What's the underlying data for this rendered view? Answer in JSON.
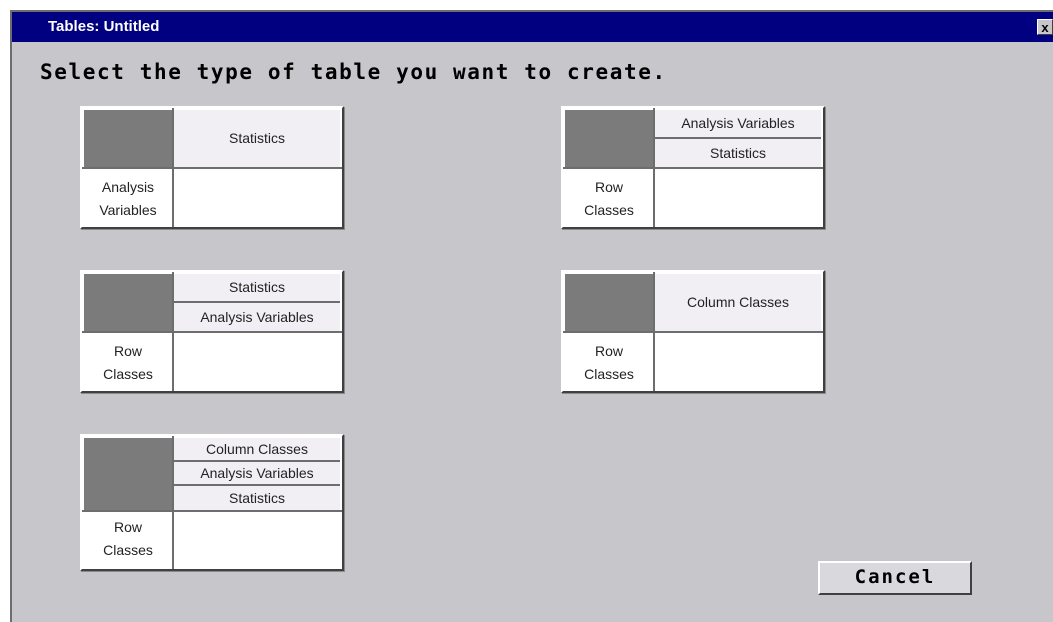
{
  "window": {
    "title": "Tables: Untitled",
    "close_label": "x"
  },
  "instruction": "Select the type of table you want to create.",
  "options": [
    {
      "headers": [
        "Statistics"
      ],
      "row_label": [
        "Analysis",
        "Variables"
      ]
    },
    {
      "headers": [
        "Analysis Variables",
        "Statistics"
      ],
      "row_label": [
        "Row",
        "Classes"
      ]
    },
    {
      "headers": [
        "Statistics",
        "Analysis Variables"
      ],
      "row_label": [
        "Row",
        "Classes"
      ]
    },
    {
      "headers": [
        "Column Classes"
      ],
      "row_label": [
        "Row",
        "Classes"
      ]
    },
    {
      "headers": [
        "Column Classes",
        "Analysis Variables",
        "Statistics"
      ],
      "row_label": [
        "Row",
        "Classes"
      ]
    }
  ],
  "cancel_label": "Cancel",
  "colors": {
    "titlebar": "#000080",
    "window_bg": "#c7c6cb",
    "corner": "#7b7b7b"
  }
}
